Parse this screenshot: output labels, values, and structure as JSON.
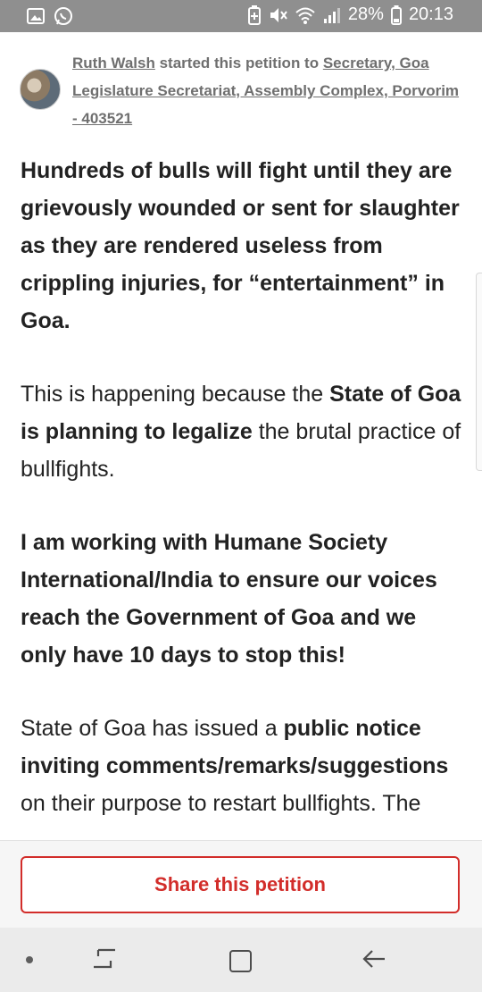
{
  "status_bar": {
    "battery_percent": "28%",
    "time": "20:13",
    "icons": [
      "gallery-icon",
      "whatsapp-icon",
      "battery-saver-icon",
      "mute-icon",
      "wifi-icon",
      "signal-icon",
      "battery-icon"
    ]
  },
  "starter": {
    "name": "Ruth Walsh",
    "started_text": " started this petition to ",
    "recipient": "Secretary, Goa Legislature Secretariat, Assembly Complex, Porvorim - 403521"
  },
  "body": {
    "p1": "Hundreds of bulls will fight until they are grievously wounded or sent for slaughter as they are rendered useless from crippling injuries, for “entertainment” in Goa.",
    "p2_pre": "This is happening because the ",
    "p2_bold": "State of Goa is planning to legalize",
    "p2_post": " the brutal practice of bullfights.",
    "p3": "I am working with Humane Society International/India to ensure our voices reach the Government of Goa and we only have 10 days to stop this!",
    "p4_pre": "State of Goa has issued a ",
    "p4_bold1": "public notice inviting comments/remarks/suggestions",
    "p4_post": " on their purpose to restart bullfights. The"
  },
  "share": {
    "label": "Share this petition"
  },
  "colors": {
    "accent": "#d22d2a",
    "status_bar": "#8f8f8f"
  }
}
